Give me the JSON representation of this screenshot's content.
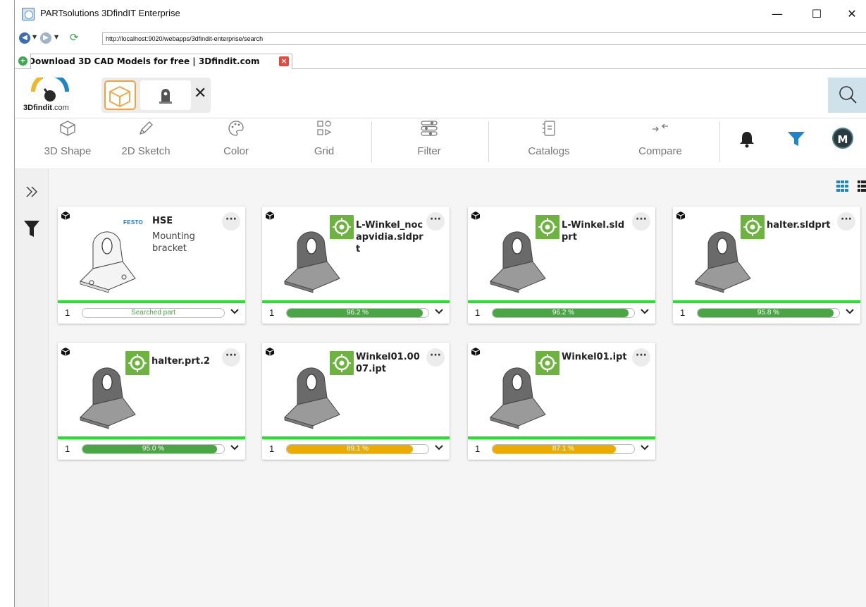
{
  "window": {
    "title": "PARTsolutions 3DfindIT Enterprise",
    "minimize": "—",
    "maximize": "☐",
    "close": "✕"
  },
  "browser": {
    "url": "http://localhost:9020/webapps/3dfindit-enterprise/search",
    "tab_title": "Download 3D CAD Models for free | 3Dfindit.com"
  },
  "logo": {
    "brand_bold": "3D",
    "brand_name": "findit",
    "brand_suffix": ".com"
  },
  "toolbar": {
    "items": [
      {
        "label": "3D Shape",
        "icon": "cube-icon"
      },
      {
        "label": "2D Sketch",
        "icon": "pencil-icon"
      },
      {
        "label": "Color",
        "icon": "palette-icon"
      },
      {
        "label": "Grid",
        "icon": "grid-icon"
      },
      {
        "label": "Filter",
        "icon": "sliders-icon"
      },
      {
        "label": "Catalogs",
        "icon": "catalog-icon"
      },
      {
        "label": "Compare",
        "icon": "compare-icon"
      }
    ],
    "avatar_initial": "M"
  },
  "colors": {
    "accent_blue": "#1e86c8",
    "green": "#4aa645",
    "orange": "#ebab00",
    "match_line": "#21e627"
  },
  "results": [
    {
      "name": "HSE",
      "brand": "FESTO",
      "desc": "Mounting bracket",
      "qty": "1",
      "score": "Searched part",
      "pct": 100,
      "color": "#ffffff",
      "searched": true
    },
    {
      "name": "L-Winkel_nocapvidia.sldprt",
      "qty": "1",
      "score": "96.2 %",
      "pct": 96.2,
      "color": "#4aa645"
    },
    {
      "name": "L-Winkel.sldprt",
      "qty": "1",
      "score": "96.2 %",
      "pct": 96.2,
      "color": "#4aa645"
    },
    {
      "name": "halter.sldprt",
      "qty": "1",
      "score": "95.8 %",
      "pct": 95.8,
      "color": "#4aa645"
    },
    {
      "name": "halter.prt.2",
      "qty": "1",
      "score": "95.0 %",
      "pct": 95.0,
      "color": "#4aa645"
    },
    {
      "name": "Winkel01.00 07.ipt",
      "qty": "1",
      "score": "89.1 %",
      "pct": 89.1,
      "color": "#ebab00"
    },
    {
      "name": "Winkel01.ipt",
      "qty": "1",
      "score": "87.1 %",
      "pct": 87.1,
      "color": "#ebab00"
    }
  ]
}
